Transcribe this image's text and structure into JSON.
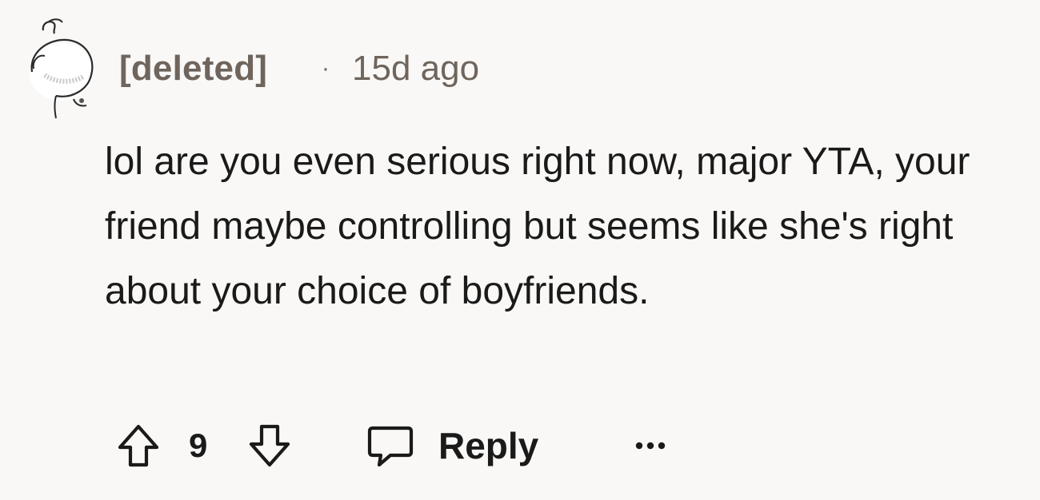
{
  "comment": {
    "author": "[deleted]",
    "separator": "·",
    "timestamp": "15d ago",
    "body": "lol are you even serious right now, major YTA, your friend maybe controlling but seems like she's right about your choice of boyfriends.",
    "score": "9",
    "actions": {
      "reply_label": "Reply",
      "upvote_icon": "upvote-arrow-icon",
      "downvote_icon": "downvote-arrow-icon",
      "reply_icon": "speech-bubble-icon",
      "more_icon": "more-options-icon"
    }
  }
}
